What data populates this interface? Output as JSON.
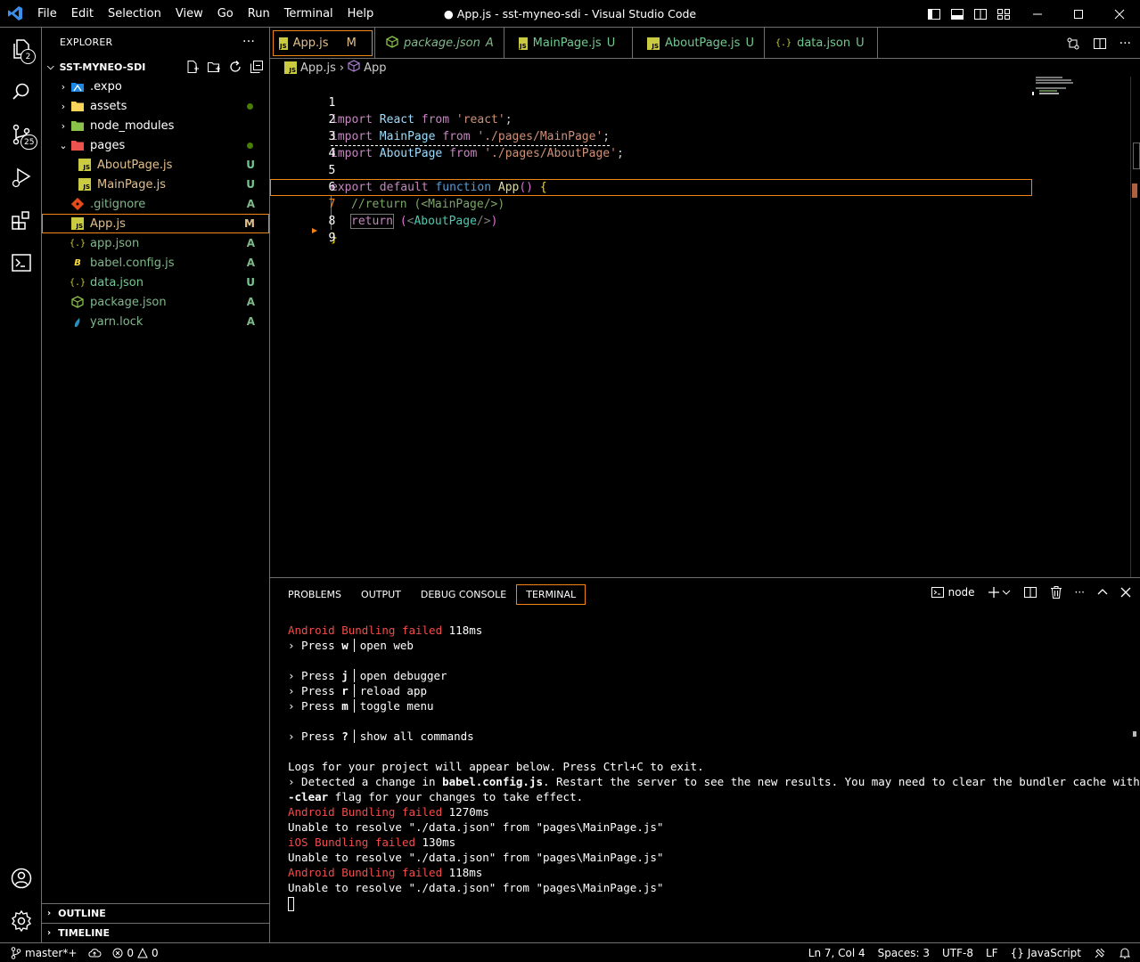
{
  "window": {
    "title": "● App.js - sst-myneo-sdi - Visual Studio Code",
    "menu": [
      "File",
      "Edit",
      "Selection",
      "View",
      "Go",
      "Run",
      "Terminal",
      "Help"
    ]
  },
  "activity_bar": {
    "explorer_badge": "2",
    "scm_badge": "25"
  },
  "explorer": {
    "header": "EXPLORER",
    "more": "···",
    "project": "SST-MYNEO-SDI",
    "items": [
      {
        "label": ".expo",
        "type": "folder",
        "deco": ""
      },
      {
        "label": "assets",
        "type": "folder",
        "deco": "dot"
      },
      {
        "label": "node_modules",
        "type": "folder",
        "deco": ""
      },
      {
        "label": "pages",
        "type": "folder-open",
        "deco": "dot"
      },
      {
        "label": "AboutPage.js",
        "type": "js",
        "deco": "U"
      },
      {
        "label": "MainPage.js",
        "type": "js",
        "deco": "U"
      },
      {
        "label": ".gitignore",
        "type": "git",
        "deco": "A"
      },
      {
        "label": "App.js",
        "type": "js",
        "deco": "M"
      },
      {
        "label": "app.json",
        "type": "json",
        "deco": "A"
      },
      {
        "label": "babel.config.js",
        "type": "babel",
        "deco": "A"
      },
      {
        "label": "data.json",
        "type": "json",
        "deco": "U"
      },
      {
        "label": "package.json",
        "type": "npm",
        "deco": "A"
      },
      {
        "label": "yarn.lock",
        "type": "yarn",
        "deco": "A"
      }
    ],
    "outline": "OUTLINE",
    "timeline": "TIMELINE"
  },
  "tabs": [
    {
      "label": "App.js",
      "status": "M",
      "dirty": true,
      "italic": false
    },
    {
      "label": "package.json",
      "status": "A",
      "dirty": false,
      "italic": true
    },
    {
      "label": "MainPage.js",
      "status": "U",
      "dirty": true,
      "italic": false
    },
    {
      "label": "AboutPage.js",
      "status": "U",
      "dirty": false,
      "italic": false
    },
    {
      "label": "data.json",
      "status": "U",
      "dirty": false,
      "italic": false
    }
  ],
  "breadcrumb": {
    "file": "App.js",
    "symbol": "App"
  },
  "editor": {
    "line_numbers": [
      "1",
      "2",
      "3",
      "4",
      "5",
      "6",
      "7",
      "8",
      "9"
    ],
    "l1": {
      "import": "import",
      "name": "React",
      "from": "from",
      "src": "'react'",
      "end": ";"
    },
    "l2": {
      "import": "import",
      "name": "MainPage",
      "from": "from",
      "src": "'./pages/MainPage'",
      "end": ";"
    },
    "l3": {
      "import": "import",
      "name": "AboutPage",
      "from": "from",
      "src": "'./pages/AboutPage'",
      "end": ";"
    },
    "l5": {
      "export": "export",
      "default": "default",
      "function": "function",
      "name": "App",
      "parens": "()",
      "brace": "{"
    },
    "l6": {
      "comment": "//return (<MainPage/>)"
    },
    "l7": {
      "return": "return",
      "open": "(",
      "lt": "<",
      "tag": "AboutPage",
      "close_tag": "/>",
      "close": ")"
    },
    "l8": {
      "brace": "}"
    }
  },
  "panel": {
    "tabs": [
      "PROBLEMS",
      "OUTPUT",
      "DEBUG CONSOLE",
      "TERMINAL"
    ],
    "active_tab": "TERMINAL",
    "terminal_name": "node"
  },
  "terminal": {
    "l1": {
      "platform": "Android",
      "status": "Bundling failed",
      "time": "118ms"
    },
    "press_w": {
      "prefix": "› Press",
      "key": "w",
      "action": "open web"
    },
    "press_j": {
      "prefix": "› Press",
      "key": "j",
      "action": "open debugger"
    },
    "press_r": {
      "prefix": "› Press",
      "key": "r",
      "action": "reload app"
    },
    "press_m": {
      "prefix": "› Press",
      "key": "m",
      "action": "toggle menu"
    },
    "press_q": {
      "prefix": "› Press",
      "key": "?",
      "action": "show all commands"
    },
    "logs": "Logs for your project will appear below. Press Ctrl+C to exit.",
    "detected_pre": "› Detected a change in ",
    "detected_file": "babel.config.js",
    "detected_post": ". Restart the server to see the new results. You may need to clear the bundler cache with the -",
    "clear_flag": "-clear",
    "clear_post": " flag for your changes to take effect.",
    "e1": {
      "platform": "Android",
      "status": "Bundling failed",
      "time": "1270ms"
    },
    "e1_msg": "Unable to resolve \"./data.json\" from \"pages\\MainPage.js\"",
    "e2": {
      "platform": "iOS",
      "status": "Bundling failed",
      "time": "130ms"
    },
    "e2_msg": "Unable to resolve \"./data.json\" from \"pages\\MainPage.js\"",
    "e3": {
      "platform": "Android",
      "status": "Bundling failed",
      "time": "118ms"
    },
    "e3_msg": "Unable to resolve \"./data.json\" from \"pages\\MainPage.js\""
  },
  "statusbar": {
    "branch": "master*+",
    "errors": "0",
    "warnings": "0",
    "position": "Ln 7, Col 4",
    "spaces": "Spaces: 3",
    "encoding": "UTF-8",
    "eol": "LF",
    "language": "JavaScript"
  }
}
